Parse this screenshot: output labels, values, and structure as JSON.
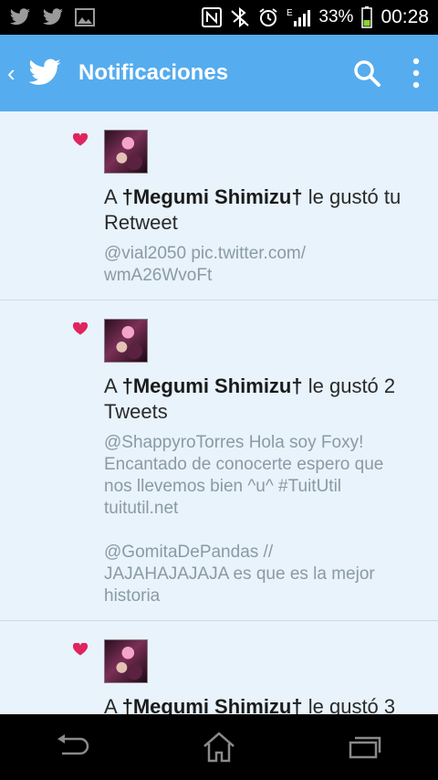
{
  "status_bar": {
    "battery": "33%",
    "time": "00:28",
    "network": "E",
    "icons": [
      "twitter-icon",
      "twitter-icon",
      "image-icon",
      "nfc-icon",
      "bluetooth-icon",
      "alarm-icon",
      "signal-icon",
      "battery-icon"
    ]
  },
  "action_bar": {
    "title": "Notificaciones",
    "up_glyph": "‹",
    "color": "#55acee"
  },
  "notifications": [
    {
      "prefix": "A ",
      "user": "†Megumi Shimizu†",
      "suffix": " le gustó tu Retweet",
      "tweets": [
        "@vial2050 pic.twitter.com/\nwmA26WvoFt"
      ]
    },
    {
      "prefix": "A ",
      "user": "†Megumi Shimizu†",
      "suffix": " le gustó 2 Tweets",
      "tweets": [
        "@ShappyroTorres Hola soy Foxy!\nEncantado de conocerte espero que\nnos llevemos bien ^u^ #TuitUtil\ntuitutil.net",
        "@GomitaDePandas //\nJAJAHAJAJAJA es que es la mejor\nhistoria"
      ]
    },
    {
      "prefix": "A ",
      "user": "†Megumi Shimizu†",
      "suffix": " le gustó 3",
      "tweets": []
    }
  ],
  "colors": {
    "heart": "#e0245e",
    "accent": "#55acee",
    "background": "#e8f3fb",
    "tweet_text": "#8a9aa6"
  },
  "nav_bar": {
    "icons": [
      "back-icon",
      "home-icon",
      "recent-apps-icon"
    ]
  }
}
